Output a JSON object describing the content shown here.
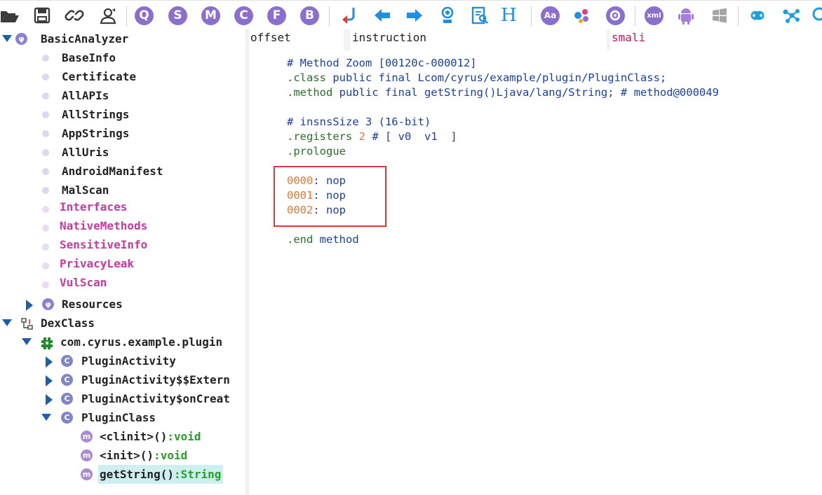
{
  "toolbar": {
    "buttons": [
      {
        "name": "open-folder-icon"
      },
      {
        "name": "save-icon"
      },
      {
        "name": "link-icon"
      },
      {
        "name": "user-refresh-icon"
      },
      {
        "name": "search-q-icon",
        "label": "Q"
      },
      {
        "name": "strings-s-icon",
        "label": "S"
      },
      {
        "name": "methods-m-icon",
        "label": "M"
      },
      {
        "name": "classes-c-icon",
        "label": "C"
      },
      {
        "name": "fields-f-icon",
        "label": "F"
      },
      {
        "name": "bytes-b-icon",
        "label": "B"
      },
      {
        "name": "jump-icon"
      },
      {
        "name": "back-arrow-icon"
      },
      {
        "name": "forward-arrow-icon"
      },
      {
        "name": "pin-icon"
      },
      {
        "name": "document-search-icon"
      },
      {
        "name": "heading-h-icon",
        "label": "H"
      },
      {
        "name": "font-aa-icon",
        "label": "Aa"
      },
      {
        "name": "palette-icon"
      },
      {
        "name": "settings-gear-icon"
      },
      {
        "name": "xml-icon",
        "label": "xml"
      },
      {
        "name": "android-icon"
      },
      {
        "name": "windows-icon"
      },
      {
        "name": "infinity-icon"
      },
      {
        "name": "network-icon"
      },
      {
        "name": "search-icon"
      }
    ],
    "colors": {
      "purple": "#8b6fcf",
      "blue": "#1f8ee6",
      "red": "#e53935",
      "android": "#a57fe0",
      "cyan": "#1aa0e0"
    }
  },
  "tree": {
    "basic_analyzer": {
      "label": "BasicAnalyzer"
    },
    "basic_children": [
      {
        "label": "BaseInfo"
      },
      {
        "label": "Certificate"
      },
      {
        "label": "AllAPIs"
      },
      {
        "label": "AllStrings"
      },
      {
        "label": "AppStrings"
      },
      {
        "label": "AllUris"
      },
      {
        "label": "AndroidManifest"
      },
      {
        "label": "MalScan"
      }
    ],
    "pink_children": [
      {
        "label": "Interfaces"
      },
      {
        "label": "NativeMethods"
      },
      {
        "label": "SensitiveInfo"
      },
      {
        "label": "PrivacyLeak"
      },
      {
        "label": "VulScan"
      }
    ],
    "resources": {
      "label": "Resources"
    },
    "dexclass": {
      "label": "DexClass"
    },
    "package": {
      "label": "com.cyrus.example.plugin"
    },
    "classes": [
      {
        "label": "PluginActivity"
      },
      {
        "label": "PluginActivity$$Extern"
      },
      {
        "label": "PluginActivity$onCreat"
      }
    ],
    "plugin_class": {
      "label": "PluginClass"
    },
    "methods": [
      {
        "name": "<clinit>()",
        "ret": ":void"
      },
      {
        "name": "<init>()",
        "ret": ":void"
      },
      {
        "name": "getString()",
        "ret": ":String"
      }
    ]
  },
  "columns": {
    "offset": "offset",
    "instruction": "instruction",
    "smali": "smali"
  },
  "code": {
    "l1": "# Method Zoom [00120c-000012]",
    "l2_kw": ".class",
    "l2_rest": " public final Lcom/cyrus/example/plugin/PluginClass;",
    "l3_kw": ".method",
    "l3_rest": " public final getString()Ljava/lang/String; # method@000049",
    "l4": "# insnsSize 3 (16-bit)",
    "l5_kw": ".registers",
    "l5_num": " 2",
    "l5_rest": " # [ v0  v1  ]",
    "l6_kw": ".prologue",
    "i1_off": "0000",
    "i1_rest": ": nop",
    "i2_off": "0001",
    "i2_rest": ": nop",
    "i3_off": "0002",
    "i3_rest": ": nop",
    "end_kw": ".end",
    "end_rest": " method"
  }
}
